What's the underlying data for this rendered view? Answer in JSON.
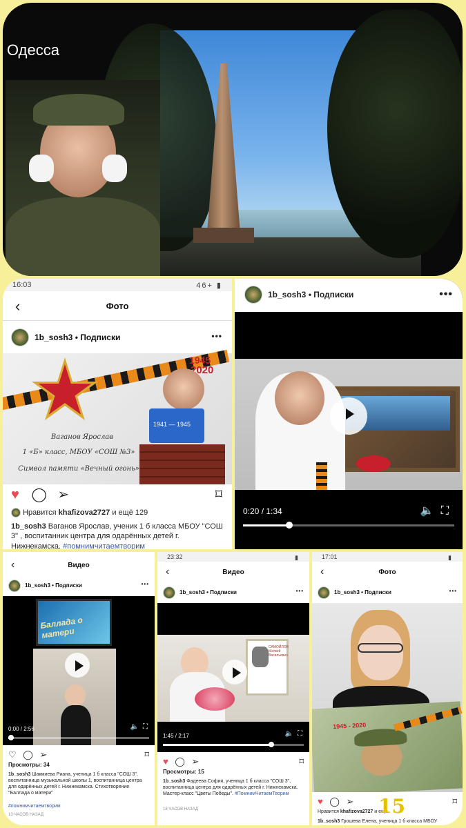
{
  "top": {
    "city_label": "Одесса"
  },
  "p2": {
    "status_time": "16:03",
    "status_right": "46+ ▮",
    "nav_title": "Фото",
    "account": "1b_sosh3 • Подписки",
    "poster": {
      "year_1945": "1945",
      "year_2020": "2020",
      "line1": "Ваганов Ярослав",
      "line2": "1 «Б» класс, МБОУ «СОШ №3»",
      "line3": "Символ памяти «Вечный огонь»",
      "sign": "1941 — 1945"
    },
    "likes_prefix": "Нравится ",
    "likes_user": "khafizova2727",
    "likes_suffix": " и ещё 129",
    "caption_user": "1b_sosh3",
    "caption_text": " Ваганов Ярослав, ученик 1 б класса МБОУ \"СОШ 3\" , воспитанник центра для одарённых детей г. Нижнекамска. ",
    "caption_tag": "#помнимчитаемтворим"
  },
  "p3": {
    "account": "1b_sosh3 • Подписки",
    "time": "0:20 / 1:34",
    "progress": 0.22
  },
  "p4": {
    "nav_title": "Видео",
    "account": "1b_sosh3 • Подписки",
    "screen_title": "Баллада о матери",
    "time": "0:00 / 2:56",
    "progress": 0.02,
    "views": "Просмотры: 34",
    "caption_user": "1b_sosh3",
    "caption_text": " Шакмиева Риана, ученица 1 б класса \"СОШ 3\", воспитанница музыкальной школы 1, воспитанница центра для одарённых детей г. Нижнекамска. Стихотворение \"Баллада о матери\"",
    "caption_tag": "#помнимчитаемтворим",
    "date": "13 ЧАСОВ НАЗАД"
  },
  "p5": {
    "status_time": "23:32",
    "nav_title": "Видео",
    "account": "1b_sosh3 • Подписки",
    "frame_text": "САМОЙЛОВ Матвей Васильевич",
    "time": "1:45 / 2:17",
    "progress": 0.77,
    "views": "Просмотры: 15",
    "caption_user": "1b_sosh3",
    "caption_text": " Фадеева София, ученица 1 б класса \"СОШ 3\", воспитанница центра для одарённых детей г. Нижнекамска. Мастер-класс \"Цветы Победы\". ",
    "caption_tag": "#ПомнимЧитаемТворим",
    "date": "18 ЧАСОВ НАЗАД"
  },
  "p6": {
    "status_time": "17:01",
    "nav_title": "Фото",
    "account": "1b_sosh3 • Подписки",
    "drawing_years": "1945 - 2020",
    "likes_prefix": "Нравится ",
    "likes_user": "khafizova2727",
    "likes_suffix": " и ещё",
    "likes_count": "15",
    "caption_user": "1b_sosh3",
    "caption_text": " Грошева Елена, ученица 1 б класса МБОУ"
  },
  "colors": {
    "background": "#f7ef9a",
    "like_red": "#ed4956",
    "tag_blue": "#3b5998",
    "count_gold": "#e6c200"
  }
}
